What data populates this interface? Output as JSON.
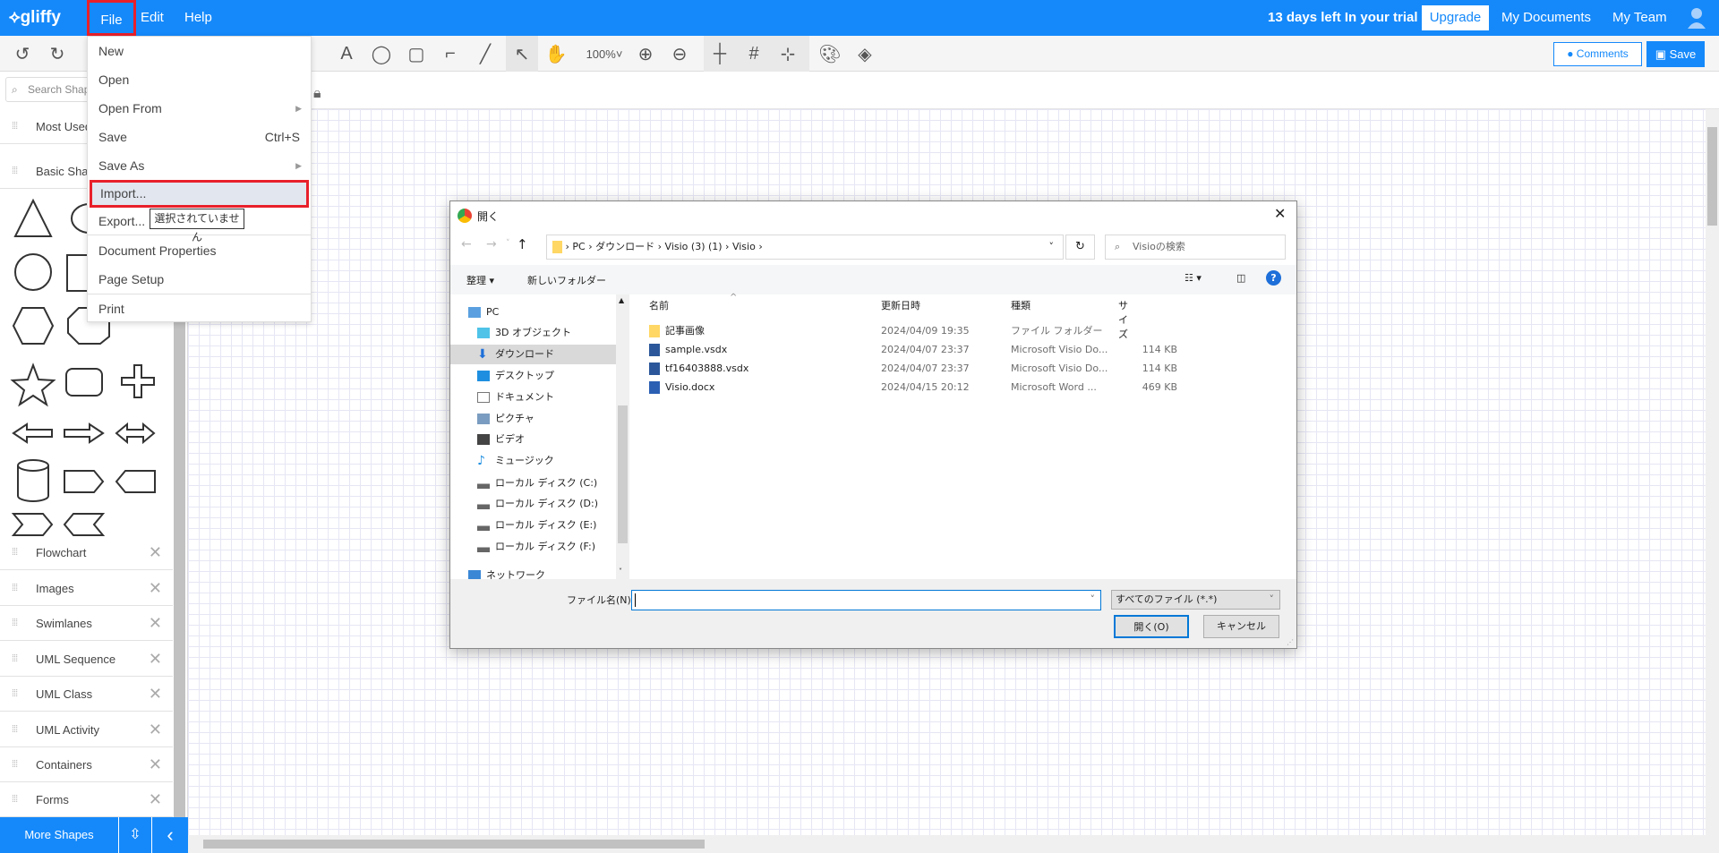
{
  "app": {
    "logo": "gliffy",
    "menus": [
      "File",
      "Edit",
      "Help"
    ],
    "trial": "13 days left In your trial",
    "upgrade": "Upgrade",
    "my_documents": "My Documents",
    "my_team": "My Team"
  },
  "toolbar": {
    "zoom": "100%",
    "comments": "Comments",
    "save": "Save"
  },
  "sidebar": {
    "search_placeholder": "Search Shapes",
    "sections": [
      "Most Used",
      "Basic Shapes",
      "Flowchart",
      "Images",
      "Swimlanes",
      "UML Sequence",
      "UML Class",
      "UML Activity",
      "Containers",
      "Forms"
    ],
    "more_shapes": "More Shapes"
  },
  "file_menu": {
    "items": [
      {
        "label": "New"
      },
      {
        "label": "Open"
      },
      {
        "label": "Open From"
      },
      {
        "label": "Save",
        "shortcut": "Ctrl+S"
      },
      {
        "label": "Save As"
      },
      {
        "label": "Import..."
      },
      {
        "label": "Export..."
      },
      {
        "label": "Document Properties"
      },
      {
        "label": "Page Setup"
      },
      {
        "label": "Print"
      }
    ],
    "tooltip": "選択されていません"
  },
  "dialog": {
    "title": "開く",
    "breadcrumb": [
      "PC",
      "ダウンロード",
      "Visio (3) (1)",
      "Visio"
    ],
    "search_placeholder": "Visioの検索",
    "organize": "整理",
    "new_folder": "新しいフォルダー",
    "nav": [
      "PC",
      "3D オブジェクト",
      "ダウンロード",
      "デスクトップ",
      "ドキュメント",
      "ピクチャ",
      "ビデオ",
      "ミュージック",
      "ローカル ディスク (C:)",
      "ローカル ディスク (D:)",
      "ローカル ディスク (E:)",
      "ローカル ディスク (F:)",
      "ネットワーク"
    ],
    "columns": [
      "名前",
      "更新日時",
      "種類",
      "サイズ"
    ],
    "files": [
      {
        "name": "記事画像",
        "date": "2024/04/09 19:35",
        "type": "ファイル フォルダー",
        "size": "",
        "icon": "folder"
      },
      {
        "name": "sample.vsdx",
        "date": "2024/04/07 23:37",
        "type": "Microsoft Visio Do...",
        "size": "114 KB",
        "icon": "visio"
      },
      {
        "name": "tf16403888.vsdx",
        "date": "2024/04/07 23:37",
        "type": "Microsoft Visio Do...",
        "size": "114 KB",
        "icon": "visio"
      },
      {
        "name": "Visio.docx",
        "date": "2024/04/15 20:12",
        "type": "Microsoft Word ...",
        "size": "469 KB",
        "icon": "word"
      }
    ],
    "filename_label": "ファイル名(N):",
    "filename_value": "",
    "filetype": "すべてのファイル (*.*)",
    "open": "開く(O)",
    "cancel": "キャンセル"
  },
  "colors": {
    "brand": "#1589fa",
    "highlight": "#e8202a"
  }
}
